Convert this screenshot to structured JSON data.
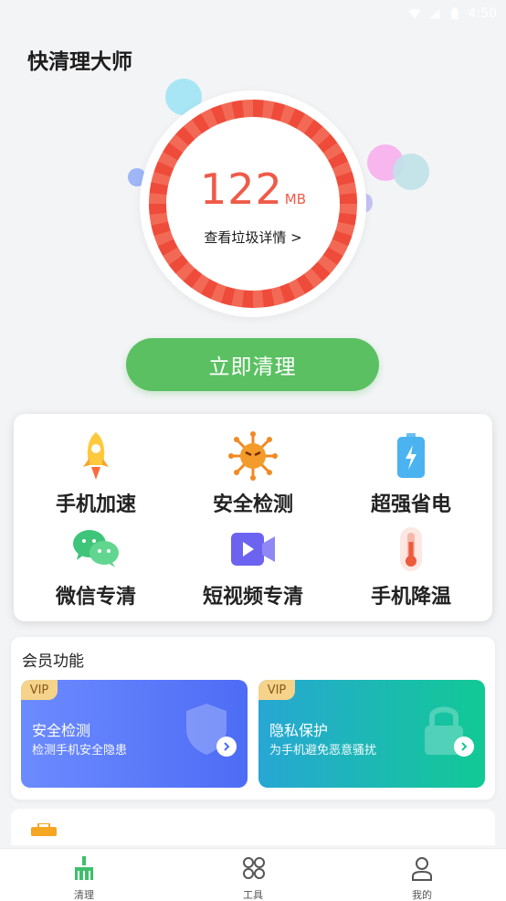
{
  "status_bar": {
    "time": "4:50"
  },
  "app": {
    "title": "快清理大师"
  },
  "junk": {
    "value": "122",
    "unit": "MB",
    "detail_link": "查看垃圾详情 >"
  },
  "clean_button": {
    "label": "立即清理"
  },
  "tools": [
    {
      "label": "手机加速",
      "icon": "rocket-icon"
    },
    {
      "label": "安全检测",
      "icon": "virus-icon"
    },
    {
      "label": "超强省电",
      "icon": "battery-icon"
    },
    {
      "label": "微信专清",
      "icon": "wechat-icon"
    },
    {
      "label": "短视频专清",
      "icon": "video-icon"
    },
    {
      "label": "手机降温",
      "icon": "thermometer-icon"
    }
  ],
  "member": {
    "title": "会员功能",
    "cards": [
      {
        "tag": "VIP",
        "name": "安全检测",
        "desc": "检测手机安全隐患",
        "color_from": "#6c8bff",
        "color_to": "#4d6cf5"
      },
      {
        "tag": "VIP",
        "name": "隐私保护",
        "desc": "为手机避免恶意骚扰",
        "color_from": "#27a7d4",
        "color_to": "#12c995"
      }
    ]
  },
  "nav": [
    {
      "label": "清理",
      "icon": "broom-icon",
      "active": true
    },
    {
      "label": "工具",
      "icon": "grid-icon",
      "active": false
    },
    {
      "label": "我的",
      "icon": "user-icon",
      "active": false
    }
  ],
  "colors": {
    "accent": "#5bc062",
    "ring": "#ef4b3a"
  }
}
